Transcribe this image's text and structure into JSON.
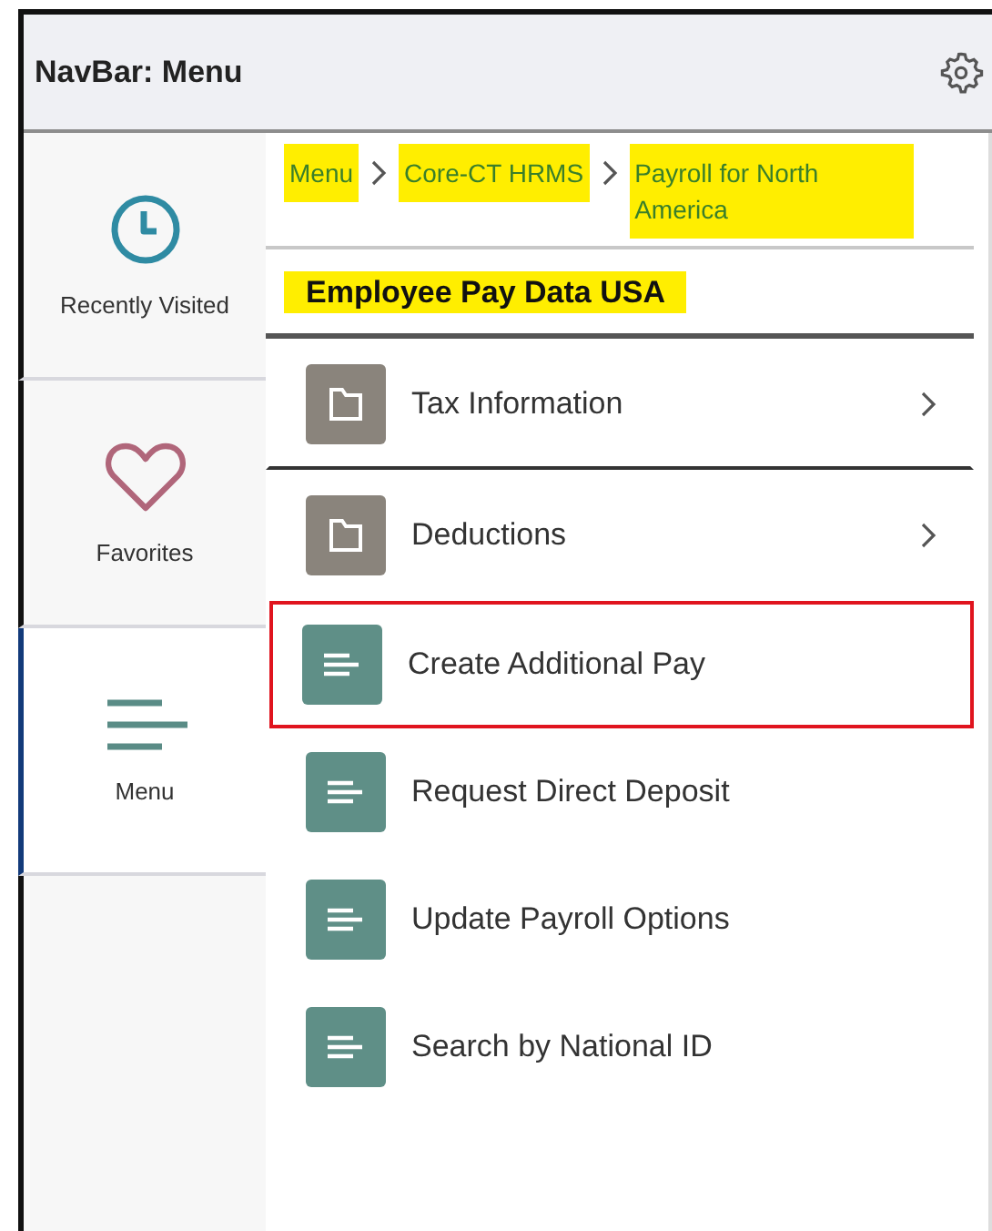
{
  "header": {
    "title": "NavBar: Menu"
  },
  "sidebar": {
    "items": [
      {
        "kind": "recent",
        "label": "Recently Visited",
        "selected": false
      },
      {
        "kind": "favorites",
        "label": "Favorites",
        "selected": false
      },
      {
        "kind": "menu",
        "label": "Menu",
        "selected": true
      }
    ]
  },
  "breadcrumb": {
    "highlighted": true,
    "items": [
      "Menu",
      "Core-CT HRMS",
      "Payroll for North America"
    ]
  },
  "page_title": {
    "text": "Employee Pay Data USA",
    "highlighted": true
  },
  "items": [
    {
      "kind": "folder",
      "label": "Tax Information",
      "outlined": false
    },
    {
      "kind": "folder",
      "label": "Deductions",
      "outlined": false
    },
    {
      "kind": "page",
      "label": "Create Additional Pay",
      "outlined": true
    },
    {
      "kind": "page",
      "label": "Request Direct Deposit",
      "outlined": false
    },
    {
      "kind": "page",
      "label": "Update Payroll Options",
      "outlined": false
    },
    {
      "kind": "page",
      "label": "Search by National ID",
      "outlined": false
    }
  ]
}
